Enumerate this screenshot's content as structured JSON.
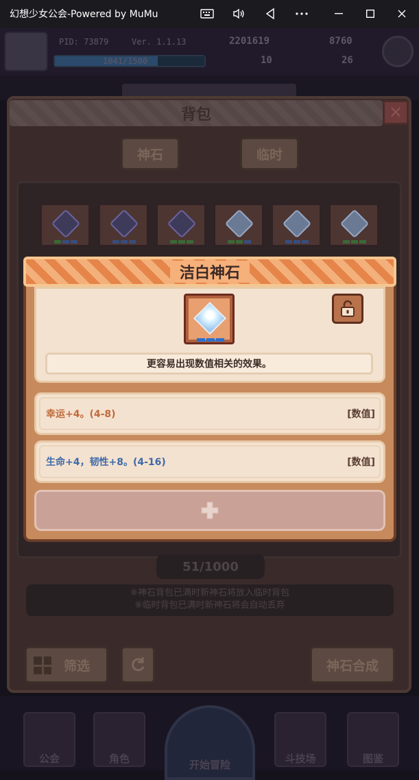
{
  "window": {
    "title": "幻想少女公会-Powered by MuMu",
    "controls": [
      "keyboard-icon",
      "volume-icon",
      "back-icon",
      "more-icon",
      "minimize-icon",
      "maximize-icon",
      "close-icon"
    ]
  },
  "hud": {
    "pid": "PID: 73879",
    "version": "Ver. 1.1.13",
    "gold": "2201619",
    "gems": "8760",
    "exp_text": "1041/1500",
    "stat_a": "10",
    "stat_b": "26"
  },
  "bag": {
    "title": "背包",
    "tabs": [
      "神石",
      "临时"
    ],
    "count": "51/1000",
    "note_1": "※神石背包已满时新神石将放入临时背包",
    "note_2": "※临时背包已满时新神石将会自动丢弃",
    "filter_label": "筛选",
    "synth_label": "神石合成",
    "slots": [
      {
        "gem": "dark",
        "dots": [
          "#2e8a3a",
          "#2b5fb0",
          "#2b5fb0"
        ]
      },
      {
        "gem": "dark",
        "dots": [
          "#2b5fb0",
          "#2b5fb0",
          "#2b5fb0"
        ]
      },
      {
        "gem": "dark",
        "dots": [
          "#2e8a3a",
          "#2e8a3a",
          "#2e8a3a"
        ]
      },
      {
        "gem": "light",
        "dots": [
          "#2e8a3a",
          "#2e8a3a",
          "#2b5fb0"
        ]
      },
      {
        "gem": "light",
        "dots": [
          "#2b5fb0",
          "#2b5fb0",
          "#2b5fb0"
        ]
      },
      {
        "gem": "light",
        "dots": [
          "#2e8a3a",
          "#2e8a3a",
          "#2e8a3a"
        ]
      }
    ]
  },
  "popup": {
    "title": "洁白神石",
    "description": "更容易出现数值相关的效果。",
    "gem_dots": [
      "#2b6fd0",
      "#2b6fd0",
      "#2b6fd0"
    ],
    "effects": [
      {
        "text": "幸运+4。(4-8)",
        "tag": "[数值]",
        "color": "#c06a3a"
      },
      {
        "text": "生命+4，韧性+8。(4-16)",
        "tag": "[数值]",
        "color": "#3e6aa8"
      }
    ],
    "add_icon": "plus-icon",
    "lock_icon": "unlock-icon"
  },
  "nav": {
    "items": [
      "公会",
      "角色",
      "开始冒险",
      "斗技场",
      "图鉴"
    ]
  }
}
